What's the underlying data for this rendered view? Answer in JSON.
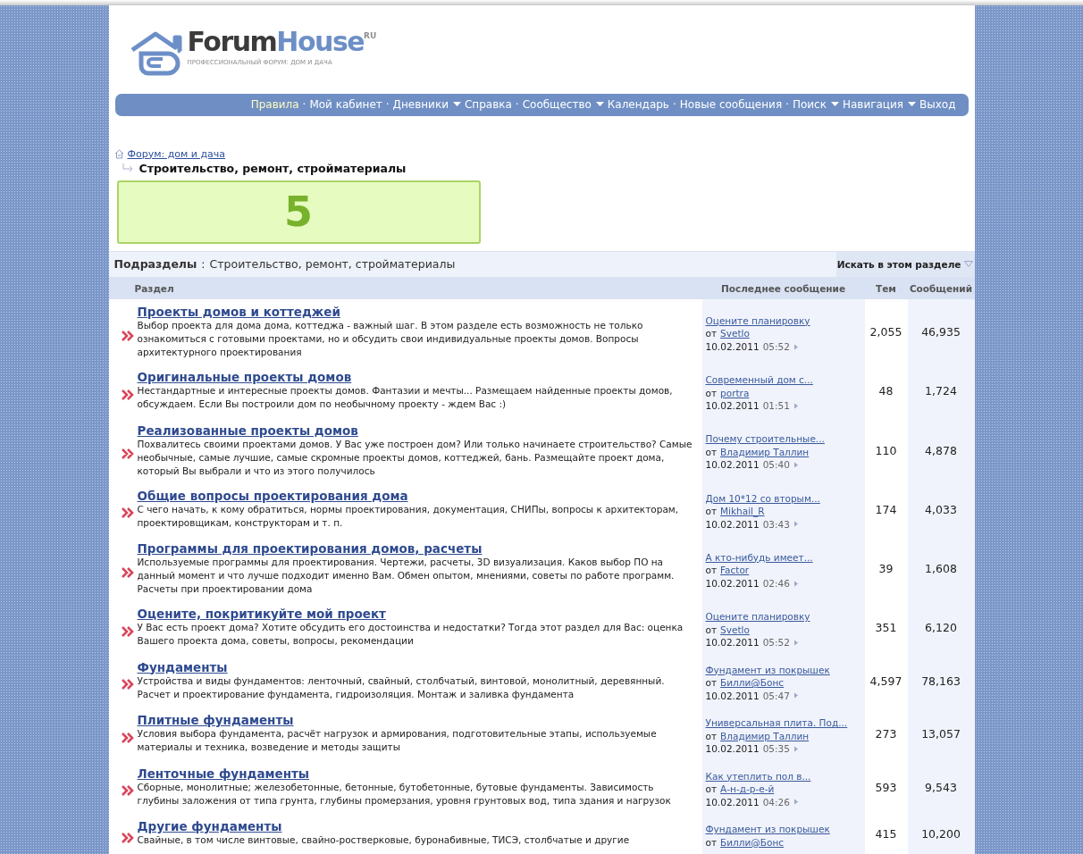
{
  "logo": {
    "word_dark": "Forum",
    "word_blue": "House",
    "suffix": "RU",
    "tagline": "ПРОФЕССИОНАЛЬНЫЙ ФОРУМ: ДОМ И ДАЧА"
  },
  "nav": [
    {
      "label": "Правила",
      "dropdown": false,
      "separator": "·"
    },
    {
      "label": "Мой кабинет",
      "dropdown": false,
      "separator": "·"
    },
    {
      "label": "Дневники",
      "dropdown": true
    },
    {
      "label": "Справка",
      "dropdown": false,
      "separator": "·"
    },
    {
      "label": "Сообщество",
      "dropdown": true
    },
    {
      "label": "Календарь",
      "dropdown": false,
      "separator": "·"
    },
    {
      "label": "Новые сообщения",
      "dropdown": false,
      "separator": "·"
    },
    {
      "label": "Поиск",
      "dropdown": true
    },
    {
      "label": "Навигация",
      "dropdown": true
    },
    {
      "label": "Выход",
      "dropdown": false
    }
  ],
  "breadcrumb": {
    "parent": "Форум: дом и дача",
    "current": "Строительство, ремонт, стройматериалы"
  },
  "banner": {
    "text": "5"
  },
  "subsections": {
    "label": "Подразделы",
    "separator": ":",
    "forum": "Строительство, ремонт, стройматериалы",
    "search": "Искать в этом разделе"
  },
  "columns": [
    "Раздел",
    "Последнее сообщение",
    "Тем",
    "Сообщений"
  ],
  "rows": [
    {
      "title": "Проекты домов и коттеджей",
      "description": "Выбор проекта для дома дома, коттеджа - важный шаг. В этом разделе есть возможность не только ознакомиться с готовыми проектами, но и обсудить свои индивидуальные проекты домов. Вопросы архитектурного проектирования",
      "thread": "Оцените планировку",
      "by": "от",
      "author": "Svetlo",
      "date": "10.02.2011",
      "time": "05:52",
      "topics": "2,055",
      "posts": "46,935"
    },
    {
      "title": "Оригинальные проекты домов",
      "description": "Нестандартные и интересные проекты домов. Фантазии и мечты... Размещаем найденные проекты домов, обсуждаем. Если Вы построили дом по необычному проекту - ждем Вас :)",
      "thread": "Современный дом с...",
      "by": "от",
      "author": "portra",
      "date": "10.02.2011",
      "time": "01:51",
      "topics": "48",
      "posts": "1,724"
    },
    {
      "title": "Реализованные проекты домов",
      "description": "Похвалитесь своими проектами домов. У Вас уже построен дом? Или только начинаете строительство? Самые необычные, самые лучшие, самые скромные проекты домов, коттеджей, бань. Размещайте проект дома, который Вы выбрали и что из этого получилось",
      "thread": "Почему строительные...",
      "by": "от",
      "author": "Владимир Таллин",
      "date": "10.02.2011",
      "time": "05:40",
      "topics": "110",
      "posts": "4,878"
    },
    {
      "title": "Общие вопросы проектирования дома",
      "description": "С чего начать, к кому обратиться, нормы проектирования, документация, СНИПы, вопросы к архитекторам, проектировщикам, конструкторам и т. п.",
      "thread": "Дом 10*12 со вторым...",
      "by": "от",
      "author": "Mikhail_R",
      "date": "10.02.2011",
      "time": "03:43",
      "topics": "174",
      "posts": "4,033"
    },
    {
      "title": "Программы для проектирования домов, расчеты",
      "description": "Используемые программы для проектирования. Чертежи, расчеты, 3D визуализация. Каков выбор ПО на данный момент и что лучше подходит именно Вам. Обмен опытом, мнениями, советы по работе программ. Расчеты при проектировании дома",
      "thread": "А кто-нибудь имеет...",
      "by": "от",
      "author": "Factor",
      "date": "10.02.2011",
      "time": "02:46",
      "topics": "39",
      "posts": "1,608"
    },
    {
      "title": "Оцените, покритикуйте мой проект",
      "description": "У Вас есть проект дома? Хотите обсудить его достоинства и недостатки? Тогда этот раздел для Вас: оценка Вашего проекта дома, советы, вопросы, рекомендации",
      "thread": "Оцените планировку",
      "by": "от",
      "author": "Svetlo",
      "date": "10.02.2011",
      "time": "05:52",
      "topics": "351",
      "posts": "6,120"
    },
    {
      "title": "Фундаменты",
      "description": "Устройства и виды фундаментов: ленточный, свайный, столбчатый, винтовой, монолитный, деревянный. Расчет и проектирование фундамента, гидроизоляция. Монтаж и заливка фундамента",
      "thread": "Фундамент из покрышек",
      "by": "от",
      "author": "Билли@Бонс",
      "date": "10.02.2011",
      "time": "05:47",
      "topics": "4,597",
      "posts": "78,163"
    },
    {
      "title": "Плитные фундаменты",
      "description": "Условия выбора фундамента, расчёт нагрузок и армирования, подготовительные этапы, используемые материалы и техника, возведение и методы защиты",
      "thread": "Универсальная плита. Под...",
      "by": "от",
      "author": "Владимир Таллин",
      "date": "10.02.2011",
      "time": "05:35",
      "topics": "273",
      "posts": "13,057"
    },
    {
      "title": "Ленточные фундаменты",
      "description": "Сборные, монолитные; железобетонные, бетонные, бутобетонные, бутовые фундаменты. Зависимость глубины заложения от типа грунта, глубины промерзания, уровня грунтовых вод, типа здания и нагрузок",
      "thread": "Как утеплить пол в...",
      "by": "от",
      "author": "А-н-д-р-е-й",
      "date": "10.02.2011",
      "time": "04:26",
      "topics": "593",
      "posts": "9,543"
    },
    {
      "title": "Другие фундаменты",
      "description": "Свайные, в том числе винтовые, свайно-ростверковые, буронабивные, ТИСЭ, столбчатые и другие",
      "thread": "Фундамент из покрышек",
      "by": "от",
      "author": "Билли@Бонс",
      "topics": "415",
      "posts": "10,200"
    }
  ]
}
